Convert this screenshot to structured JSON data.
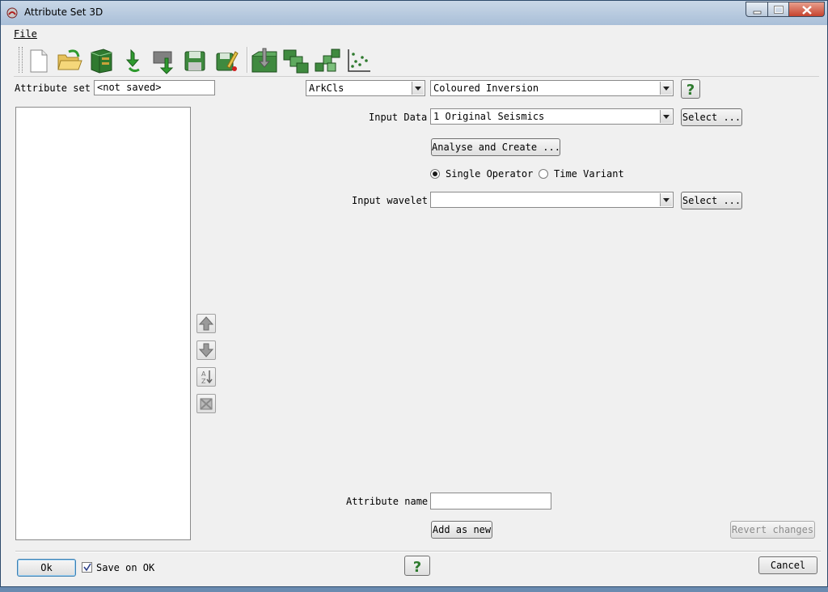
{
  "window": {
    "title": "Attribute Set 3D"
  },
  "menu": {
    "file": "File"
  },
  "toolbar": {
    "icons": [
      "new-file-icon",
      "open-folder-icon",
      "database-icon",
      "reload-icon",
      "import-icon",
      "save-icon",
      "save-as-icon",
      "import-attributes-icon",
      "merge-sets-icon",
      "flow-icon",
      "scatter-plot-icon"
    ]
  },
  "attribute_set": {
    "label": "Attribute set",
    "value": "<not saved>"
  },
  "group_combo": {
    "value": "ArkCls"
  },
  "attribute_combo": {
    "value": "Coloured Inversion"
  },
  "input_data": {
    "label": "Input Data",
    "value": "1 Original Seismics",
    "select_label": "Select ..."
  },
  "analyse_button": "Analyse and Create ...",
  "operator": {
    "options": [
      {
        "label": "Single Operator",
        "selected": true
      },
      {
        "label": "Time Variant",
        "selected": false
      }
    ]
  },
  "input_wavelet": {
    "label": "Input wavelet",
    "value": "",
    "select_label": "Select ..."
  },
  "attribute_name": {
    "label": "Attribute name",
    "value": ""
  },
  "add_as_new": "Add as new",
  "revert_changes": "Revert changes",
  "footer": {
    "ok": "Ok",
    "save_on_ok": "Save on OK",
    "save_on_ok_checked": true,
    "cancel": "Cancel"
  }
}
